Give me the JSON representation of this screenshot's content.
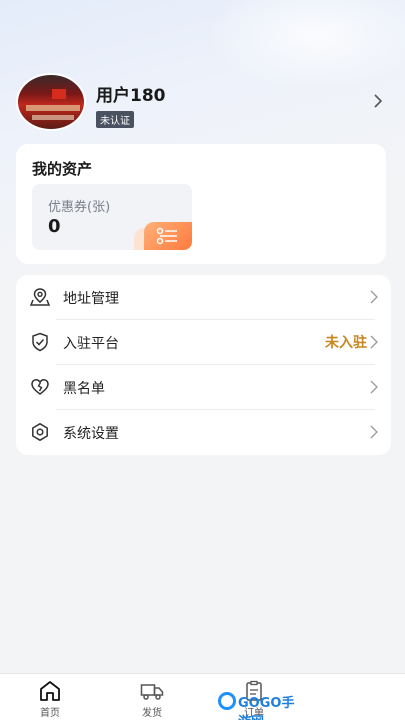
{
  "profile": {
    "username": "用户180",
    "status_badge": "未认证"
  },
  "assets": {
    "title": "我的资产",
    "coupon_label": "优惠券(张)",
    "coupon_value": "0"
  },
  "menu": {
    "items": [
      {
        "label": "地址管理",
        "icon": "location-map-icon"
      },
      {
        "label": "入驻平台",
        "icon": "shield-check-icon",
        "extra": "未入驻"
      },
      {
        "label": "黑名单",
        "icon": "broken-heart-icon"
      },
      {
        "label": "系统设置",
        "icon": "gear-hexagon-icon"
      }
    ]
  },
  "tabbar": {
    "items": [
      {
        "label": "首页",
        "icon": "home-icon"
      },
      {
        "label": "发货",
        "icon": "truck-icon"
      },
      {
        "label": "订单",
        "icon": "clipboard-icon"
      },
      {
        "label": "",
        "icon": ""
      }
    ]
  },
  "watermark": {
    "text": "GOGO手游网"
  },
  "colors": {
    "accent_orange": "#ff7a3c",
    "status_gold": "#c8861e",
    "badge_bg": "#4a5160"
  }
}
